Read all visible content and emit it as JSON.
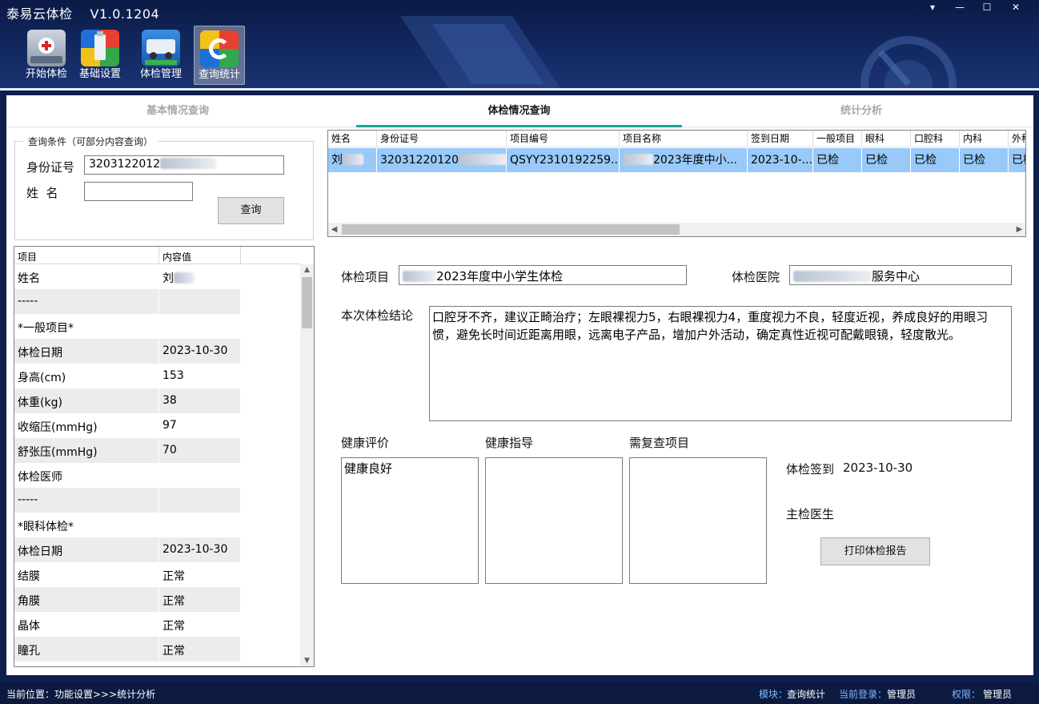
{
  "window": {
    "title": "泰易云体检",
    "version": "V1.0.1204",
    "controls": [
      "▾",
      "—",
      "☐",
      "✕"
    ]
  },
  "ribbon": [
    {
      "label": "开始体检",
      "icon": "medical-kit-icon"
    },
    {
      "label": "基础设置",
      "icon": "usb-settings-icon"
    },
    {
      "label": "体检管理",
      "icon": "vehicle-icon"
    },
    {
      "label": "查询统计",
      "icon": "refresh-stats-icon",
      "active": true
    }
  ],
  "tabs": [
    {
      "label": "基本情况查询"
    },
    {
      "label": "体检情况查询",
      "active": true
    },
    {
      "label": "统计分析"
    }
  ],
  "query": {
    "legend": "查询条件（可部分内容查询）",
    "id_label": "身份证号",
    "id_value": "3203122012",
    "name_label": "姓  名",
    "name_value": "",
    "search_button": "查询"
  },
  "detail_grid": {
    "headers": [
      "项目",
      "内容值"
    ],
    "rows": [
      {
        "item": "姓名",
        "value": "刘"
      },
      {
        "item": "-----",
        "value": ""
      },
      {
        "item": "*一般项目*",
        "value": ""
      },
      {
        "item": "体检日期",
        "value": "2023-10-30"
      },
      {
        "item": "身高(cm)",
        "value": "153"
      },
      {
        "item": "体重(kg)",
        "value": "38"
      },
      {
        "item": "收缩压(mmHg)",
        "value": "97"
      },
      {
        "item": "舒张压(mmHg)",
        "value": "70"
      },
      {
        "item": "体检医师",
        "value": ""
      },
      {
        "item": "-----",
        "value": ""
      },
      {
        "item": "*眼科体检*",
        "value": ""
      },
      {
        "item": "体检日期",
        "value": "2023-10-30"
      },
      {
        "item": "结膜",
        "value": "正常"
      },
      {
        "item": "角膜",
        "value": "正常"
      },
      {
        "item": "晶体",
        "value": "正常"
      },
      {
        "item": "瞳孔",
        "value": "正常"
      }
    ]
  },
  "list_grid": {
    "headers": [
      "姓名",
      "身份证号",
      "项目编号",
      "项目名称",
      "签到日期",
      "一般项目",
      "眼科",
      "口腔科",
      "内科",
      "外科"
    ],
    "rows": [
      [
        "刘",
        "32031220120",
        "QSYY2310192259...",
        "2023年度中小...",
        "2023-10-...",
        "已检",
        "已检",
        "已检",
        "已检",
        "已检"
      ]
    ]
  },
  "form": {
    "project_label": "体检项目",
    "project_value": "2023年度中小学生体检",
    "hospital_label": "体检医院",
    "hospital_value": "服务中心",
    "conclusion_label": "本次体检结论",
    "conclusion_value": "口腔牙不齐，建议正畸治疗；左眼裸视力5，右眼裸视力4，重度视力不良，轻度近视，养成良好的用眼习惯，避免长时间近距离用眼，远离电子产品，增加户外活动，确定真性近视可配戴眼镜，轻度散光。",
    "eval_label": "健康评价",
    "eval_value": "健康良好",
    "guide_label": "健康指导",
    "guide_value": "",
    "recheck_label": "需复查项目",
    "recheck_value": "",
    "signin_label": "体检签到",
    "signin_value": "2023-10-30",
    "doctor_label": "主检医生",
    "print_button": "打印体检报告"
  },
  "status": {
    "location_label": "当前位置：",
    "location_value": "功能设置>>>统计分析",
    "module_label": "模块：",
    "module_value": "查询统计",
    "login_label": "当前登录：",
    "login_value": "管理员",
    "perm_label": "权限：",
    "perm_value": "管理员"
  }
}
